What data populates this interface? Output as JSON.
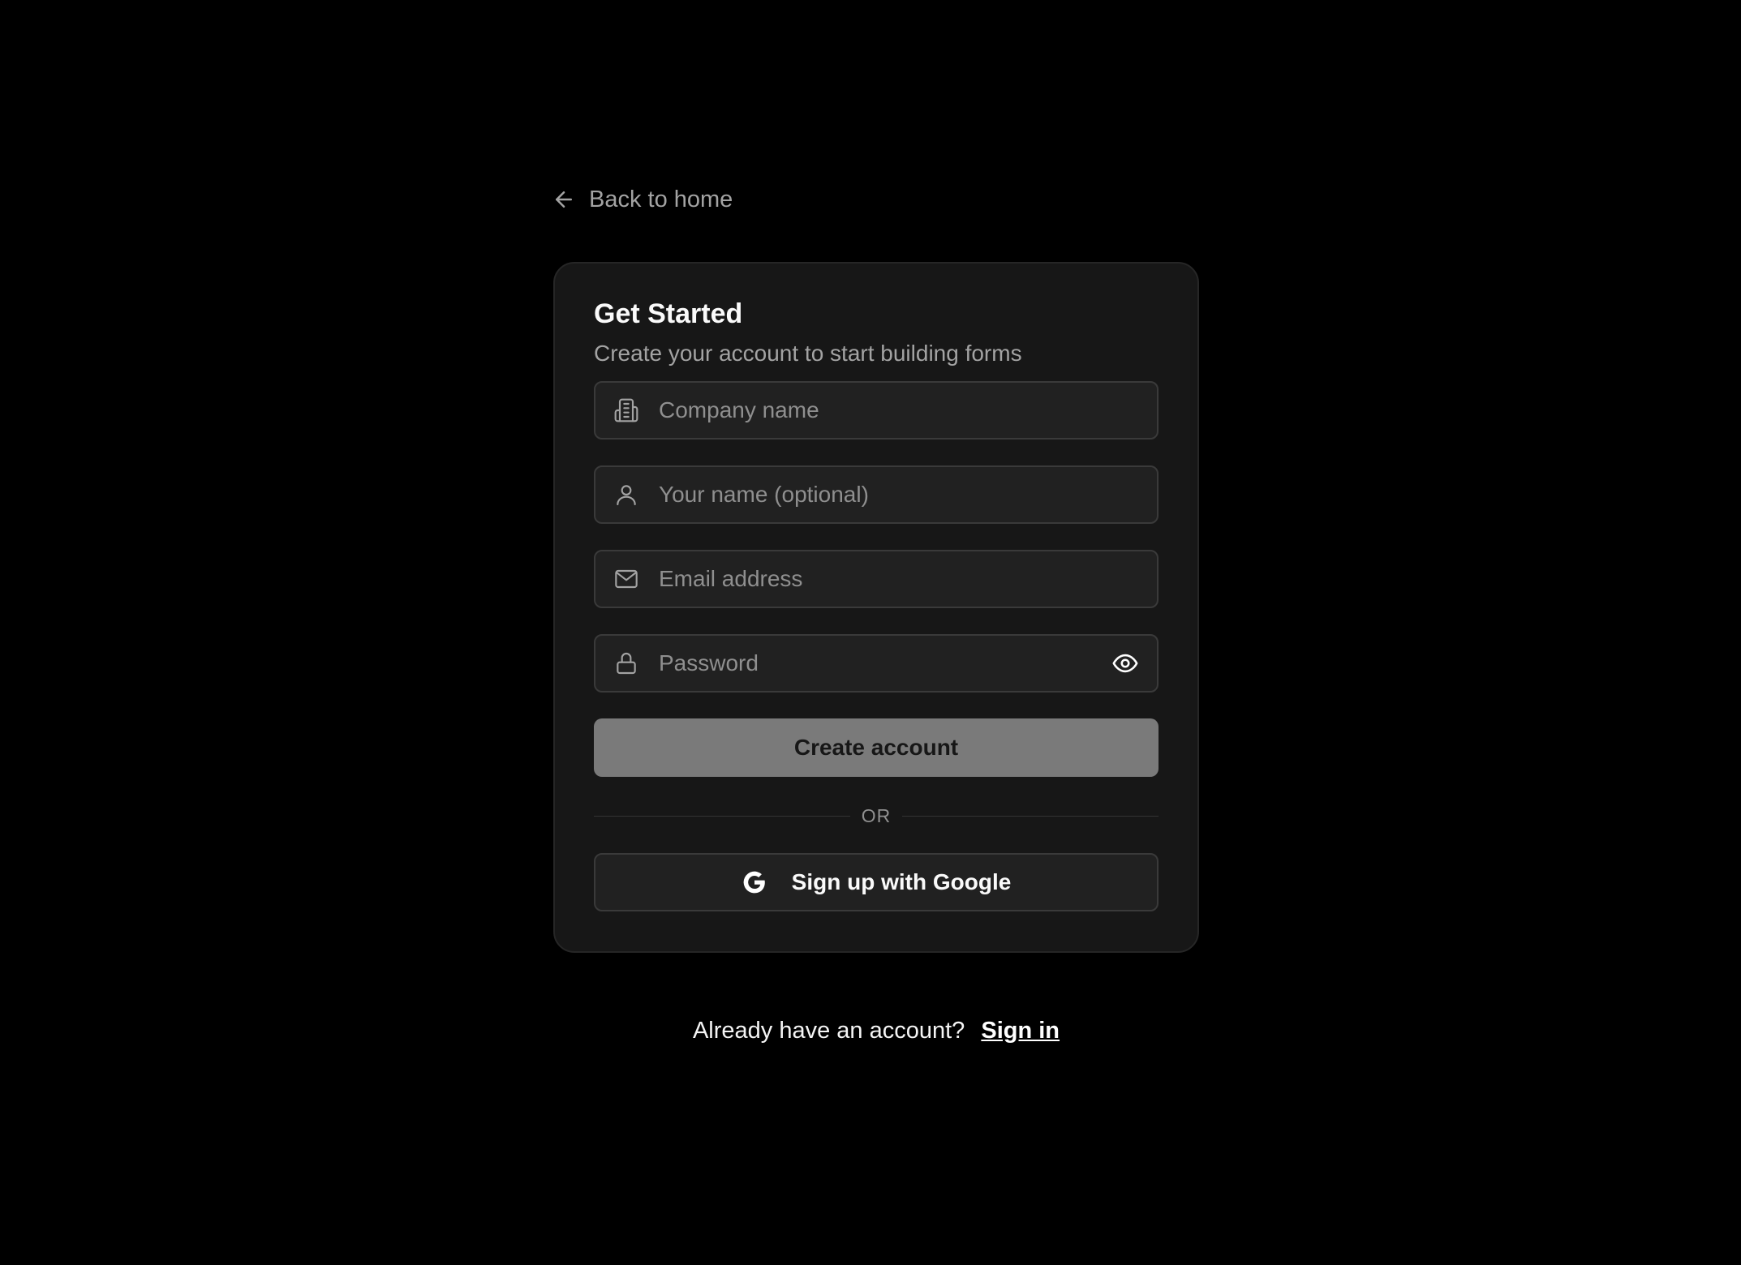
{
  "back_link": {
    "label": "Back to home",
    "icon": "arrow-left-icon"
  },
  "card": {
    "title": "Get Started",
    "subtitle": "Create your account to start building forms"
  },
  "form": {
    "company": {
      "placeholder": "Company name",
      "value": "",
      "icon": "building-icon"
    },
    "name": {
      "placeholder": "Your name (optional)",
      "value": "",
      "icon": "user-icon"
    },
    "email": {
      "placeholder": "Email address",
      "value": "",
      "icon": "mail-icon"
    },
    "password": {
      "placeholder": "Password",
      "value": "",
      "icon": "lock-icon",
      "toggle_icon": "eye-icon"
    },
    "submit_label": "Create account"
  },
  "divider_label": "OR",
  "google": {
    "label": "Sign up with Google",
    "icon": "google-icon"
  },
  "footer": {
    "prompt": "Already have an account?",
    "link_label": "Sign in"
  },
  "colors": {
    "background": "#000000",
    "card": "#171717",
    "input": "#212121",
    "primary_button": "#7a7a7a"
  }
}
